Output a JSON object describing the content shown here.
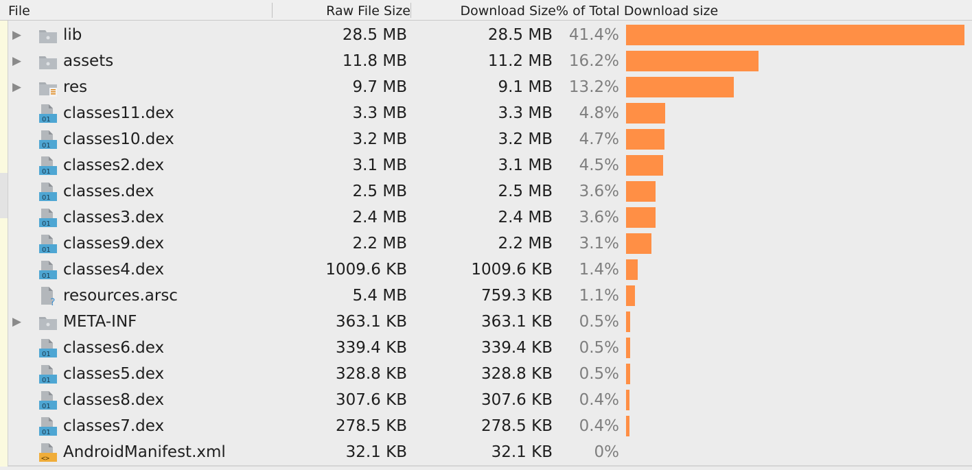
{
  "table": {
    "headers": {
      "file": "File",
      "raw": "Raw File Size",
      "download": "Download Size",
      "percent": "% of Total Download size"
    },
    "rows": [
      {
        "name": "lib",
        "raw": "28.5 MB",
        "download": "28.5 MB",
        "percent": "41.4%",
        "type": "folder",
        "expandable": true,
        "fraction": 0.414
      },
      {
        "name": "assets",
        "raw": "11.8 MB",
        "download": "11.2 MB",
        "percent": "16.2%",
        "type": "folder",
        "expandable": true,
        "fraction": 0.162
      },
      {
        "name": "res",
        "raw": "9.7 MB",
        "download": "9.1 MB",
        "percent": "13.2%",
        "type": "res-folder",
        "expandable": true,
        "fraction": 0.132
      },
      {
        "name": "classes11.dex",
        "raw": "3.3 MB",
        "download": "3.3 MB",
        "percent": "4.8%",
        "type": "dex",
        "expandable": false,
        "fraction": 0.048
      },
      {
        "name": "classes10.dex",
        "raw": "3.2 MB",
        "download": "3.2 MB",
        "percent": "4.7%",
        "type": "dex",
        "expandable": false,
        "fraction": 0.047
      },
      {
        "name": "classes2.dex",
        "raw": "3.1 MB",
        "download": "3.1 MB",
        "percent": "4.5%",
        "type": "dex",
        "expandable": false,
        "fraction": 0.045
      },
      {
        "name": "classes.dex",
        "raw": "2.5 MB",
        "download": "2.5 MB",
        "percent": "3.6%",
        "type": "dex",
        "expandable": false,
        "fraction": 0.036
      },
      {
        "name": "classes3.dex",
        "raw": "2.4 MB",
        "download": "2.4 MB",
        "percent": "3.6%",
        "type": "dex",
        "expandable": false,
        "fraction": 0.036
      },
      {
        "name": "classes9.dex",
        "raw": "2.2 MB",
        "download": "2.2 MB",
        "percent": "3.1%",
        "type": "dex",
        "expandable": false,
        "fraction": 0.031
      },
      {
        "name": "classes4.dex",
        "raw": "1009.6 KB",
        "download": "1009.6 KB",
        "percent": "1.4%",
        "type": "dex",
        "expandable": false,
        "fraction": 0.014
      },
      {
        "name": "resources.arsc",
        "raw": "5.4 MB",
        "download": "759.3 KB",
        "percent": "1.1%",
        "type": "unknown",
        "expandable": false,
        "fraction": 0.011
      },
      {
        "name": "META-INF",
        "raw": "363.1 KB",
        "download": "363.1 KB",
        "percent": "0.5%",
        "type": "folder",
        "expandable": true,
        "fraction": 0.005
      },
      {
        "name": "classes6.dex",
        "raw": "339.4 KB",
        "download": "339.4 KB",
        "percent": "0.5%",
        "type": "dex",
        "expandable": false,
        "fraction": 0.005
      },
      {
        "name": "classes5.dex",
        "raw": "328.8 KB",
        "download": "328.8 KB",
        "percent": "0.5%",
        "type": "dex",
        "expandable": false,
        "fraction": 0.005
      },
      {
        "name": "classes8.dex",
        "raw": "307.6 KB",
        "download": "307.6 KB",
        "percent": "0.4%",
        "type": "dex",
        "expandable": false,
        "fraction": 0.004
      },
      {
        "name": "classes7.dex",
        "raw": "278.5 KB",
        "download": "278.5 KB",
        "percent": "0.4%",
        "type": "dex",
        "expandable": false,
        "fraction": 0.004
      },
      {
        "name": "AndroidManifest.xml",
        "raw": "32.1 KB",
        "download": "32.1 KB",
        "percent": "0%",
        "type": "xml",
        "expandable": false,
        "fraction": 0.0
      }
    ]
  },
  "icons": {
    "expand": "triangle-right-icon",
    "folder": "folder-icon",
    "res-folder": "resource-folder-icon",
    "dex": "dex-file-icon",
    "unknown": "unknown-file-icon",
    "xml": "xml-file-icon"
  },
  "colors": {
    "bar": "#ff8f45",
    "percent_text": "#7e7e7e",
    "dex_badge": "#4ea6d3",
    "xml_badge": "#f0ad3a"
  },
  "expand_glyph": "▶",
  "dex_badge_text": "01",
  "unknown_badge_text": "?",
  "xml_badge_text": "<>"
}
